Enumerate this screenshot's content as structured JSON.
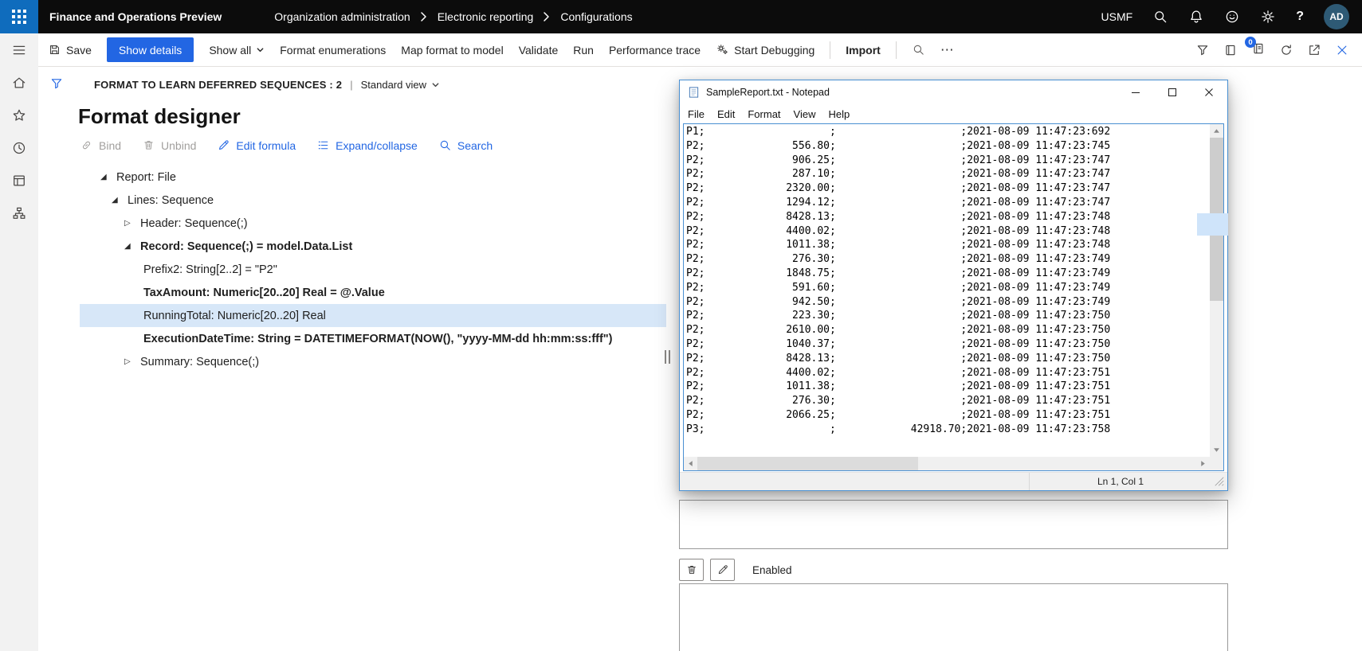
{
  "colors": {
    "accent_blue": "#2266E3",
    "waffle_blue": "#0f6cbd",
    "topbar_black": "#0c0c0c",
    "selected_row": "#d7e7f8"
  },
  "topbar": {
    "app_title": "Finance and Operations Preview",
    "breadcrumb": [
      "Organization administration",
      "Electronic reporting",
      "Configurations"
    ],
    "company": "USMF",
    "help": "?",
    "avatar_initials": "AD"
  },
  "action_bar": {
    "save": "Save",
    "show_details": "Show details",
    "show_all": "Show all",
    "format_enumerations": "Format enumerations",
    "map_format_to_model": "Map format to model",
    "validate": "Validate",
    "run": "Run",
    "performance_trace": "Performance trace",
    "start_debugging": "Start Debugging",
    "import": "Import",
    "more": "⋯",
    "badge_count": "0"
  },
  "page": {
    "caption": "FORMAT TO LEARN DEFERRED SEQUENCES : 2",
    "caption_separator": "|",
    "view_selector": "Standard view",
    "title": "Format designer",
    "toolbar": {
      "bind": "Bind",
      "unbind": "Unbind",
      "edit_formula": "Edit formula",
      "expand_collapse": "Expand/collapse",
      "search": "Search"
    },
    "tree": [
      {
        "label": "Report: File",
        "level": 0,
        "expander": "expanded",
        "bold": false,
        "selected": false
      },
      {
        "label": "Lines: Sequence",
        "level": 1,
        "expander": "expanded",
        "bold": false,
        "selected": false
      },
      {
        "label": "Header: Sequence(;)",
        "level": 2,
        "expander": "collapsed",
        "bold": false,
        "selected": false
      },
      {
        "label": "Record: Sequence(;) = model.Data.List",
        "level": 2,
        "expander": "expanded",
        "bold": true,
        "selected": false
      },
      {
        "label": "Prefix2: String[2..2] = \"P2\"",
        "level": 3,
        "expander": "none",
        "bold": false,
        "selected": false
      },
      {
        "label": "TaxAmount: Numeric[20..20] Real = @.Value",
        "level": 3,
        "expander": "none",
        "bold": true,
        "selected": false
      },
      {
        "label": "RunningTotal: Numeric[20..20] Real",
        "level": 3,
        "expander": "none",
        "bold": false,
        "selected": true
      },
      {
        "label": "ExecutionDateTime: String = DATETIMEFORMAT(NOW(), \"yyyy-MM-dd hh:mm:ss:fff\")",
        "level": 3,
        "expander": "none",
        "bold": true,
        "selected": false
      },
      {
        "label": "Summary: Sequence(;)",
        "level": 2,
        "expander": "collapsed",
        "bold": false,
        "selected": false
      }
    ]
  },
  "notepad": {
    "window_title": "SampleReport.txt - Notepad",
    "menus": [
      "File",
      "Edit",
      "Format",
      "View",
      "Help"
    ],
    "status": "Ln 1, Col 1",
    "field_width": 20,
    "records": [
      {
        "prefix": "P1",
        "amount": "",
        "total": "",
        "timestamp": "2021-08-09 11:47:23:692"
      },
      {
        "prefix": "P2",
        "amount": "556.80",
        "total": "",
        "timestamp": "2021-08-09 11:47:23:745"
      },
      {
        "prefix": "P2",
        "amount": "906.25",
        "total": "",
        "timestamp": "2021-08-09 11:47:23:747"
      },
      {
        "prefix": "P2",
        "amount": "287.10",
        "total": "",
        "timestamp": "2021-08-09 11:47:23:747"
      },
      {
        "prefix": "P2",
        "amount": "2320.00",
        "total": "",
        "timestamp": "2021-08-09 11:47:23:747"
      },
      {
        "prefix": "P2",
        "amount": "1294.12",
        "total": "",
        "timestamp": "2021-08-09 11:47:23:747"
      },
      {
        "prefix": "P2",
        "amount": "8428.13",
        "total": "",
        "timestamp": "2021-08-09 11:47:23:748"
      },
      {
        "prefix": "P2",
        "amount": "4400.02",
        "total": "",
        "timestamp": "2021-08-09 11:47:23:748"
      },
      {
        "prefix": "P2",
        "amount": "1011.38",
        "total": "",
        "timestamp": "2021-08-09 11:47:23:748"
      },
      {
        "prefix": "P2",
        "amount": "276.30",
        "total": "",
        "timestamp": "2021-08-09 11:47:23:749"
      },
      {
        "prefix": "P2",
        "amount": "1848.75",
        "total": "",
        "timestamp": "2021-08-09 11:47:23:749"
      },
      {
        "prefix": "P2",
        "amount": "591.60",
        "total": "",
        "timestamp": "2021-08-09 11:47:23:749"
      },
      {
        "prefix": "P2",
        "amount": "942.50",
        "total": "",
        "timestamp": "2021-08-09 11:47:23:749"
      },
      {
        "prefix": "P2",
        "amount": "223.30",
        "total": "",
        "timestamp": "2021-08-09 11:47:23:750"
      },
      {
        "prefix": "P2",
        "amount": "2610.00",
        "total": "",
        "timestamp": "2021-08-09 11:47:23:750"
      },
      {
        "prefix": "P2",
        "amount": "1040.37",
        "total": "",
        "timestamp": "2021-08-09 11:47:23:750"
      },
      {
        "prefix": "P2",
        "amount": "8428.13",
        "total": "",
        "timestamp": "2021-08-09 11:47:23:750"
      },
      {
        "prefix": "P2",
        "amount": "4400.02",
        "total": "",
        "timestamp": "2021-08-09 11:47:23:751"
      },
      {
        "prefix": "P2",
        "amount": "1011.38",
        "total": "",
        "timestamp": "2021-08-09 11:47:23:751"
      },
      {
        "prefix": "P2",
        "amount": "276.30",
        "total": "",
        "timestamp": "2021-08-09 11:47:23:751"
      },
      {
        "prefix": "P2",
        "amount": "2066.25",
        "total": "",
        "timestamp": "2021-08-09 11:47:23:751"
      },
      {
        "prefix": "P3",
        "amount": "",
        "total": "42918.70",
        "timestamp": "2021-08-09 11:47:23:758"
      }
    ]
  },
  "details_panel": {
    "enabled_label": "Enabled"
  }
}
